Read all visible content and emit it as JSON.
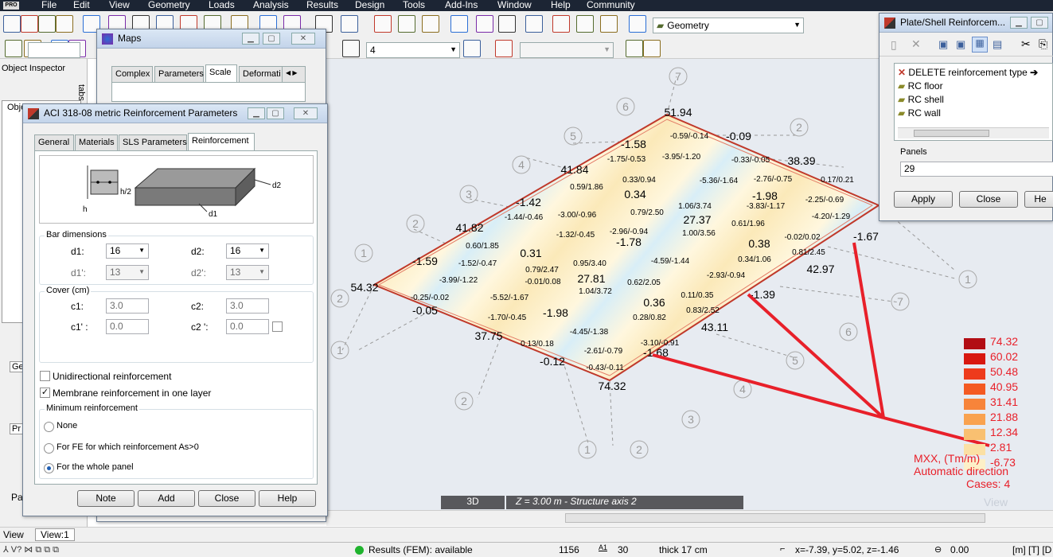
{
  "menu": {
    "logo": "PRO",
    "items": [
      "File",
      "Edit",
      "View",
      "Geometry",
      "Loads",
      "Analysis",
      "Results",
      "Design",
      "Tools",
      "Add-Ins",
      "Window",
      "Help",
      "Community"
    ]
  },
  "toolbar": {
    "layout_select": "Geometry",
    "case_select": "4"
  },
  "object_inspector": {
    "title": "Object Inspector",
    "tree_label": "Obje",
    "side_tabs": "tabs",
    "bottom_tab": "Pa",
    "side_label_ge": "Ge",
    "side_label_pr": "Pr"
  },
  "maps": {
    "title": "Maps",
    "tabs": [
      "Complex",
      "Parameters",
      "Scale",
      "Deformati"
    ],
    "selected_tab": "Scale"
  },
  "aci": {
    "title": "ACI 318-08 metric Reinforcement Parameters",
    "tabs": [
      "General",
      "Materials",
      "SLS Parameters",
      "Reinforcement"
    ],
    "selected_tab": "Reinforcement",
    "diagram": {
      "h2": "h/2",
      "h": "h",
      "d1": "d1",
      "d2": "d2"
    },
    "bar_dimensions": {
      "legend": "Bar dimensions",
      "d1_label": "d1:",
      "d1_value": "16",
      "d2_label": "d2:",
      "d2_value": "16",
      "d1p_label": "d1':",
      "d1p_value": "13",
      "d2p_label": "d2':",
      "d2p_value": "13"
    },
    "cover": {
      "legend": "Cover (cm)",
      "c1_label": "c1:",
      "c1_value": "3.0",
      "c2_label": "c2:",
      "c2_value": "3.0",
      "c1p_label": "c1' :",
      "c1p_value": "0.0",
      "c2p_label": "c2 ':",
      "c2p_value": "0.0"
    },
    "unidirectional": {
      "label": "Unidirectional reinforcement",
      "checked": false
    },
    "membrane": {
      "label": "Membrane reinforcement in one layer",
      "checked": true
    },
    "minimum": {
      "legend": "Minimum reinforcement",
      "options": [
        "None",
        "For FE for which reinforcement As>0",
        "For the whole panel"
      ],
      "selected": 2
    },
    "buttons": {
      "note": "Note",
      "add": "Add",
      "close": "Close",
      "help": "Help"
    }
  },
  "plate": {
    "title": "Plate/Shell Reinforcem...",
    "types": [
      "DELETE reinforcement type",
      "RC floor",
      "RC shell",
      "RC wall"
    ],
    "panels_label": "Panels",
    "panels_value": "29",
    "apply": "Apply",
    "close": "Close",
    "help": "He"
  },
  "view": {
    "mode": "3D",
    "axis": "Z = 3.00 m - Structure axis 2",
    "view_label": "View",
    "view_value": "View:1",
    "watermark": "View"
  },
  "legend": {
    "values": [
      "74.32",
      "60.02",
      "50.48",
      "40.95",
      "31.41",
      "21.88",
      "12.34",
      "2.81",
      "-6.73"
    ],
    "colors": [
      "#b20d14",
      "#d8180f",
      "#ee3b1c",
      "#f45a22",
      "#f7843a",
      "#f9a24f",
      "#f9c071",
      "#fbe0a4",
      "#fdf0c8"
    ],
    "title": "MXX, (Tm/m)",
    "subtitle": "Automatic direction",
    "cases": "Cases: 4"
  },
  "grid_labels": [
    "7",
    "6",
    "5",
    "4",
    "3",
    "2",
    "1",
    "2",
    "1",
    "2",
    "3",
    "4",
    "5",
    "6",
    "7",
    "1",
    "2",
    "1",
    "2"
  ],
  "map_values": [
    "51.94",
    "-0.59/-0.14",
    "-0.09",
    "-1.58",
    "-1.75/-0.53",
    "-3.95/-1.20",
    "-0.33/-0.05",
    "38.39",
    "41.84",
    "0.33/0.94",
    "-5.36/-1.64",
    "-2.76/-0.75",
    "0.17/0.21",
    "0.59/1.86",
    "0.34",
    "-1.98",
    "-2.25/-0.69",
    "-1.42",
    "1.06/3.74",
    "-3.83/-1.17",
    "-1.44/-0.46",
    "-3.00/-0.96",
    "0.79/2.50",
    "27.37",
    "-4.20/-1.29",
    "41.82",
    "-2.96/-0.94",
    "1.00/3.56",
    "0.61/1.96",
    "-1.32/-0.45",
    "-1.78",
    "0.38",
    "-0.02/0.02",
    "-1.67",
    "0.60/1.85",
    "0.31",
    "0.81/2.45",
    "-1.59",
    "-1.52/-0.47",
    "0.95/3.40",
    "-4.59/-1.44",
    "0.34/1.06",
    "0.79/2.47",
    "27.81",
    "42.97",
    "-3.99/-1.22",
    "-0.01/0.08",
    "0.62/2.05",
    "-2.93/-0.94",
    "54.32",
    "1.04/3.72",
    "-0.25/-0.02",
    "-5.52/-1.67",
    "0.11/0.35",
    "-1.39",
    "-0.05",
    "0.36",
    "-1.70/-0.45",
    "-1.98",
    "0.83/2.52",
    "0.28/0.82",
    "-4.45/-1.38",
    "43.11",
    "37.75",
    "0.13/0.18",
    "-3.10/-0.91",
    "-2.61/-0.79",
    "-1.68",
    "-0.12",
    "-0.43/-0.11",
    "74.32"
  ],
  "status": {
    "results": "Results (FEM): available",
    "count": "1156",
    "a1": "A1",
    "a1_val": "30",
    "thick": "thick 17 cm",
    "coords": "x=-7.39, y=5.02, z=-1.46",
    "angle": "0.00",
    "units": "[m] [T] [D"
  }
}
